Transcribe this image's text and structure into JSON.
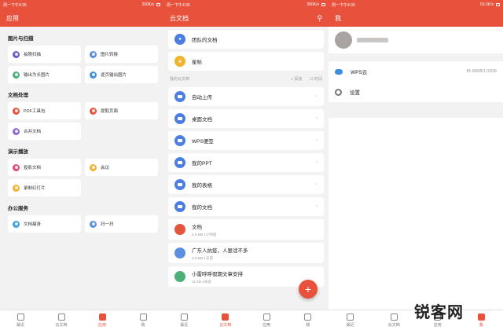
{
  "status": {
    "left_time_text": "周一下午4:35",
    "speed_1": "360K/s",
    "speed_2": "360K/s",
    "speed_3": "53.0K/s"
  },
  "screen1": {
    "title": "应用",
    "sections": [
      {
        "title": "图片与扫描",
        "items": [
          {
            "label": "拍照扫描",
            "color": "#6a5cc9"
          },
          {
            "label": "图片转换",
            "color": "#5b8fe0"
          },
          {
            "label": "输出为长图片",
            "color": "#4cb07a"
          },
          {
            "label": "逐页输出图片",
            "color": "#3f8fd9"
          }
        ]
      },
      {
        "title": "文档处理",
        "items": [
          {
            "label": "PDF工具包",
            "color": "#e4553f"
          },
          {
            "label": "提取页面",
            "color": "#e4553f"
          },
          {
            "label": "合并文档",
            "color": "#8a6ad6"
          }
        ]
      },
      {
        "title": "演示播放",
        "items": [
          {
            "label": "投影文档",
            "color": "#e24c78"
          },
          {
            "label": "会议",
            "color": "#f0b431"
          },
          {
            "label": "录制幻灯片",
            "color": "#f0b431"
          }
        ]
      },
      {
        "title": "办公服务",
        "items": [
          {
            "label": "文档瘦身",
            "color": "#3f9de0"
          },
          {
            "label": "扫一扫",
            "color": "#5b8fe0"
          }
        ]
      }
    ]
  },
  "screen2": {
    "title": "云文档",
    "top_rows": [
      {
        "label": "团队的文档",
        "color": "#4d7fe0"
      },
      {
        "label": "星标",
        "color": "#f0b431"
      }
    ],
    "section_label": "我的云文档",
    "add_label": "添加",
    "time_label": "时间",
    "folders": [
      "自动上传",
      "桌面文档",
      "WPS便签",
      "我的PPT",
      "我的表格",
      "我的文档"
    ],
    "files": [
      {
        "name": "文档",
        "meta": "3.6 MB   1小时前",
        "color": "#e4553f"
      },
      {
        "name": "广东人抗疫，人狠话不多",
        "meta": "3.6 MB   1天前",
        "color": "#5b8fe0"
      },
      {
        "name": "小雷呼呼假期文章安排",
        "meta": "11 KB   1天前",
        "color": "#4cb07a"
      }
    ],
    "fab": "+"
  },
  "screen3": {
    "title": "我",
    "cloud_label": "WPS云",
    "cloud_value": "85.68MB/1.02GB",
    "settings_label": "设置"
  },
  "tabs": {
    "recent": "最近",
    "cloud": "云文档",
    "apps": "应用",
    "me": "我"
  },
  "watermark": "锐客网"
}
